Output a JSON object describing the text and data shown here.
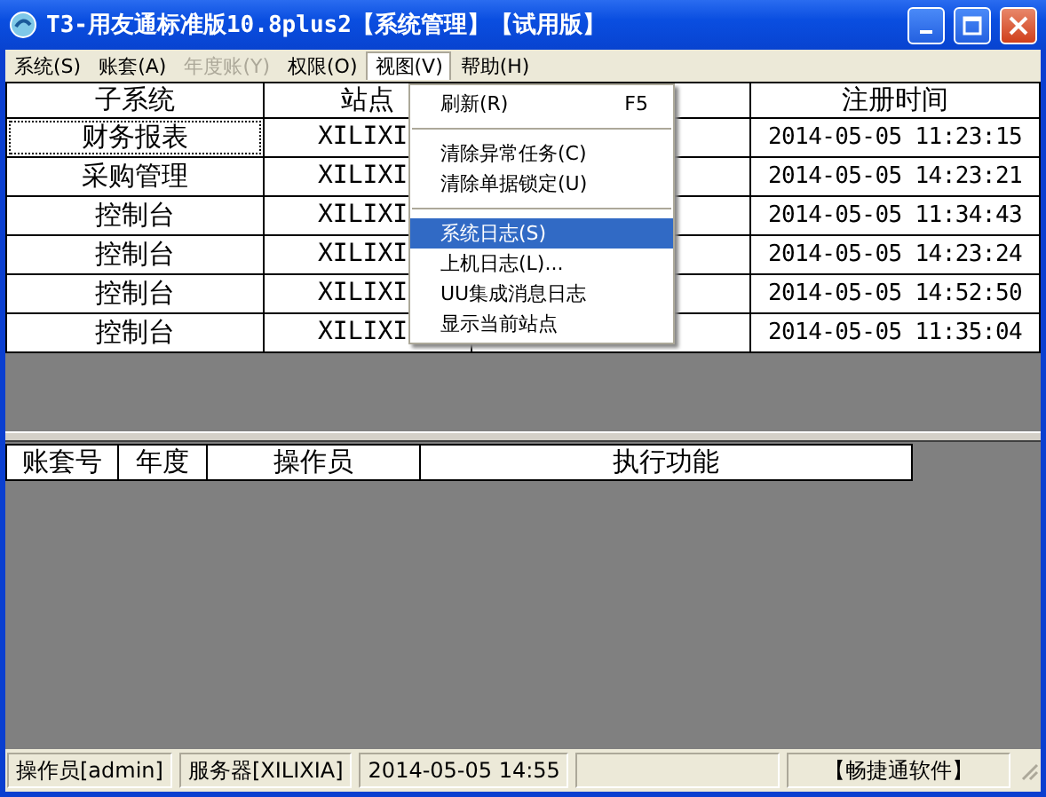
{
  "window": {
    "title": "T3-用友通标准版10.8plus2【系统管理】【试用版】"
  },
  "menu_bar": [
    {
      "label": "系统(S)",
      "disabled": false,
      "selected": false
    },
    {
      "label": "账套(A)",
      "disabled": false,
      "selected": false
    },
    {
      "label": "年度账(Y)",
      "disabled": true,
      "selected": false
    },
    {
      "label": "权限(O)",
      "disabled": false,
      "selected": false
    },
    {
      "label": "视图(V)",
      "disabled": false,
      "selected": true
    },
    {
      "label": "帮助(H)",
      "disabled": false,
      "selected": false
    }
  ],
  "dropdown": [
    {
      "kind": "item",
      "label": "刷新(R)",
      "shortcut": "F5",
      "selected": false
    },
    {
      "kind": "separator"
    },
    {
      "kind": "item",
      "label": "清除异常任务(C)",
      "selected": false
    },
    {
      "kind": "item",
      "label": "清除单据锁定(U)",
      "selected": false
    },
    {
      "kind": "separator"
    },
    {
      "kind": "item",
      "label": "系统日志(S)",
      "selected": true
    },
    {
      "kind": "item",
      "label": "上机日志(L)...",
      "selected": false
    },
    {
      "kind": "item",
      "label": "UU集成消息日志",
      "selected": false
    },
    {
      "kind": "item",
      "label": "显示当前站点",
      "selected": false
    }
  ],
  "sessions_table": {
    "columns": [
      "子系统",
      "站点",
      "注册时间"
    ],
    "rows": [
      {
        "subsystem": "财务报表",
        "station": "XILIXI",
        "time": "2014-05-05 11:23:15",
        "focused": true
      },
      {
        "subsystem": "采购管理",
        "station": "XILIXI",
        "time": "2014-05-05 14:23:21",
        "focused": false
      },
      {
        "subsystem": "控制台",
        "station": "XILIXI",
        "time": "2014-05-05 11:34:43",
        "focused": false
      },
      {
        "subsystem": "控制台",
        "station": "XILIXI",
        "time": "2014-05-05 14:23:24",
        "focused": false
      },
      {
        "subsystem": "控制台",
        "station": "XILIXI",
        "time": "2014-05-05 14:52:50",
        "focused": false
      },
      {
        "subsystem": "控制台",
        "station": "XILIXI",
        "time": "2014-05-05 11:35:04",
        "focused": false
      }
    ]
  },
  "tasks_table": {
    "columns": [
      "账套号",
      "年度",
      "操作员",
      "执行功能"
    ]
  },
  "status_bar": [
    "操作员[admin]",
    "服务器[XILIXIA]",
    "2014-05-05 14:55",
    "【畅捷通软件】"
  ]
}
